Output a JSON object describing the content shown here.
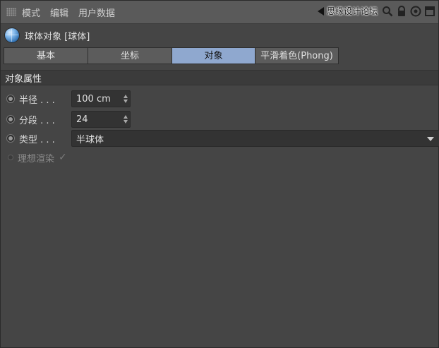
{
  "menubar": {
    "items": [
      "模式",
      "编辑",
      "用户数据"
    ],
    "watermark": "思缘设计论坛"
  },
  "object": {
    "title": "球体对象 [球体]"
  },
  "tabs": [
    {
      "label": "基本",
      "active": false
    },
    {
      "label": "坐标",
      "active": false
    },
    {
      "label": "对象",
      "active": true
    },
    {
      "label": "平滑着色(Phong)",
      "active": false
    }
  ],
  "section": {
    "title": "对象属性"
  },
  "properties": {
    "radius": {
      "label": "半径 . . .",
      "value": "100 cm"
    },
    "segments": {
      "label": "分段 . . .",
      "value": "24"
    },
    "type": {
      "label": "类型 . . .",
      "value": "半球体"
    },
    "render_perfect": {
      "label": "理想渲染",
      "checked": true
    }
  },
  "colors": {
    "active_tab": "#8fa8cf",
    "panel_bg": "#454545"
  }
}
